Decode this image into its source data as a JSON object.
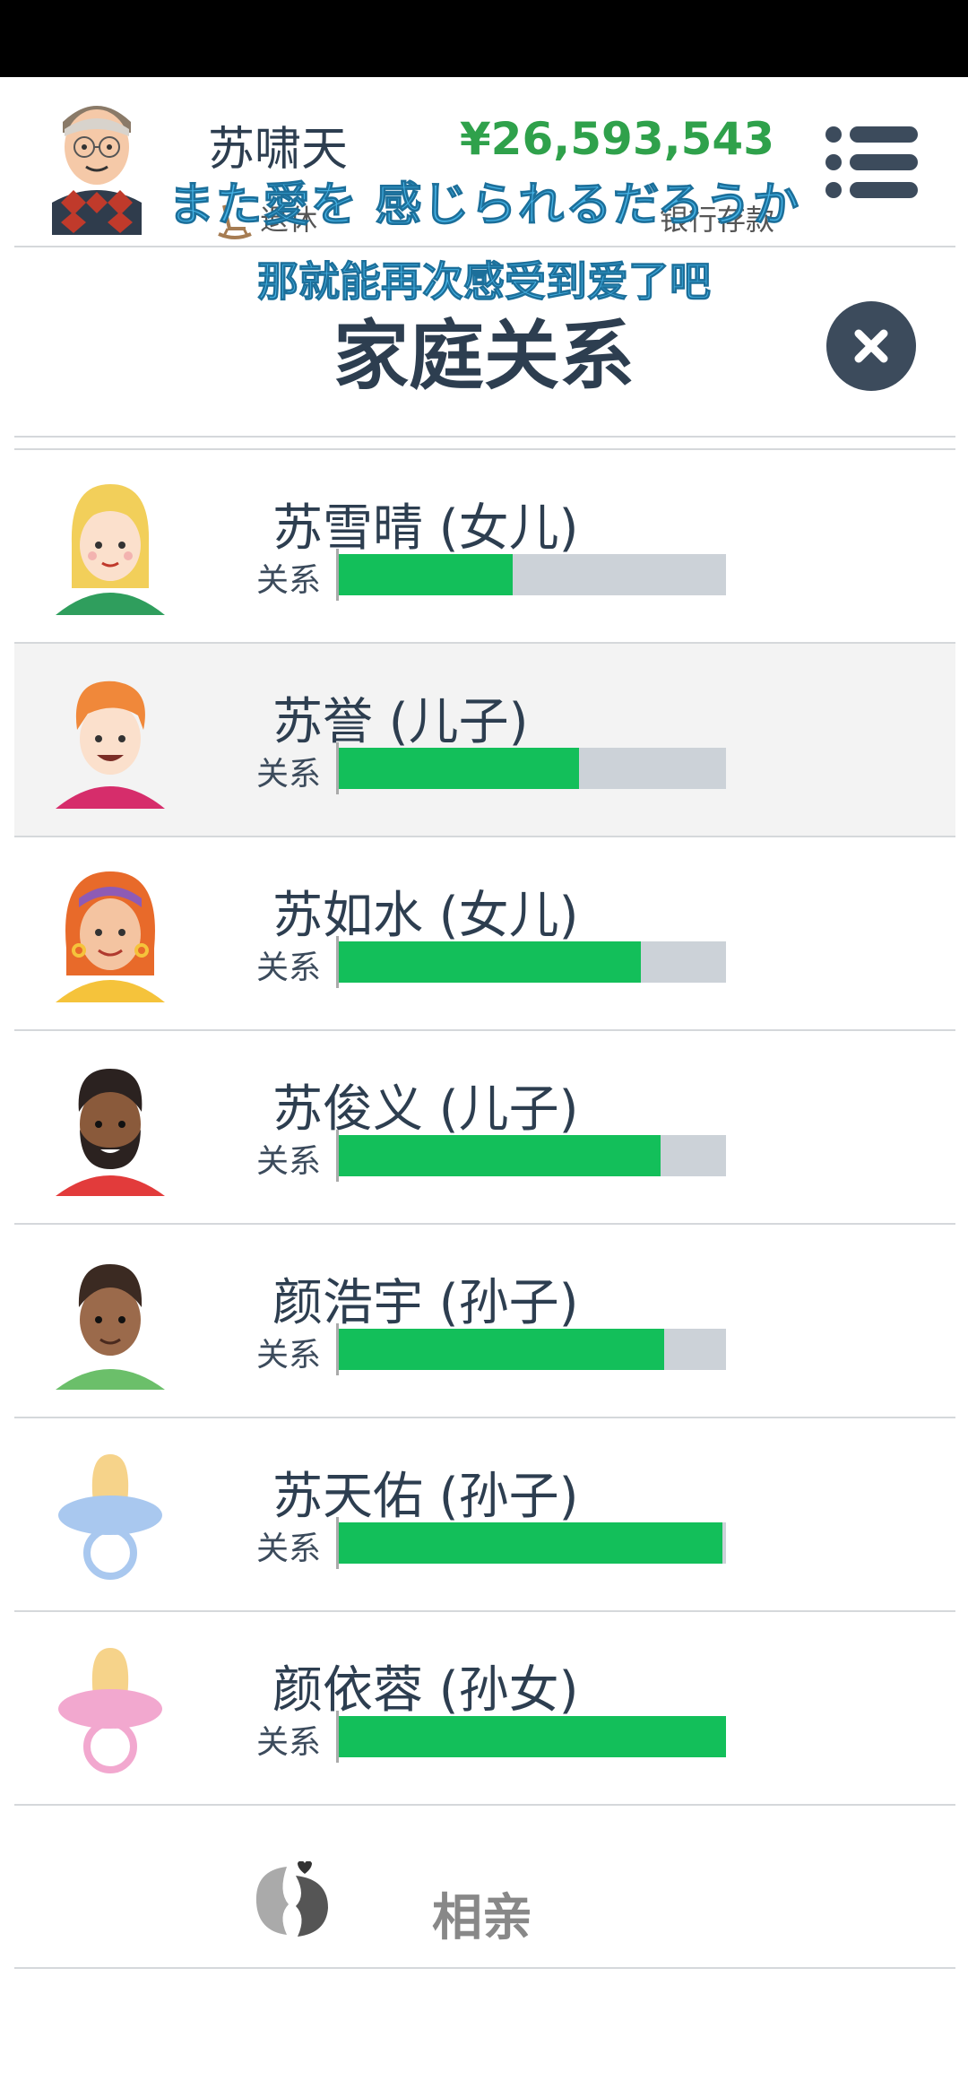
{
  "header": {
    "player_name": "苏啸天",
    "status": "退休",
    "money": "¥26,593,543",
    "money_label": "银行存款"
  },
  "overlay": {
    "line1": "また愛を 感じられるだろうか",
    "line2": "那就能再次感受到爱了吧"
  },
  "page": {
    "title": "家庭关系"
  },
  "family": [
    {
      "name": "苏雪晴 (女儿)",
      "relation_label": "关系",
      "relation": 0.45,
      "avatar": "blonde-girl"
    },
    {
      "name": "苏誉 (儿子)",
      "relation_label": "关系",
      "relation": 0.62,
      "avatar": "redhead-boy"
    },
    {
      "name": "苏如水 (女儿)",
      "relation_label": "关系",
      "relation": 0.78,
      "avatar": "headband-girl"
    },
    {
      "name": "苏俊义 (儿子)",
      "relation_label": "关系",
      "relation": 0.83,
      "avatar": "bearded-man"
    },
    {
      "name": "颜浩宇 (孙子)",
      "relation_label": "关系",
      "relation": 0.84,
      "avatar": "boy"
    },
    {
      "name": "苏天佑 (孙子)",
      "relation_label": "关系",
      "relation": 0.99,
      "avatar": "pacifier-blue"
    },
    {
      "name": "颜依蓉 (孙女)",
      "relation_label": "关系",
      "relation": 1.0,
      "avatar": "pacifier-pink"
    }
  ],
  "actions": {
    "dating_label": "相亲"
  },
  "colors": {
    "accent_green": "#13bf5a",
    "bar_bg": "#ccd2d8",
    "money_green": "#2fa14b",
    "title_dark": "#2d3e50"
  }
}
